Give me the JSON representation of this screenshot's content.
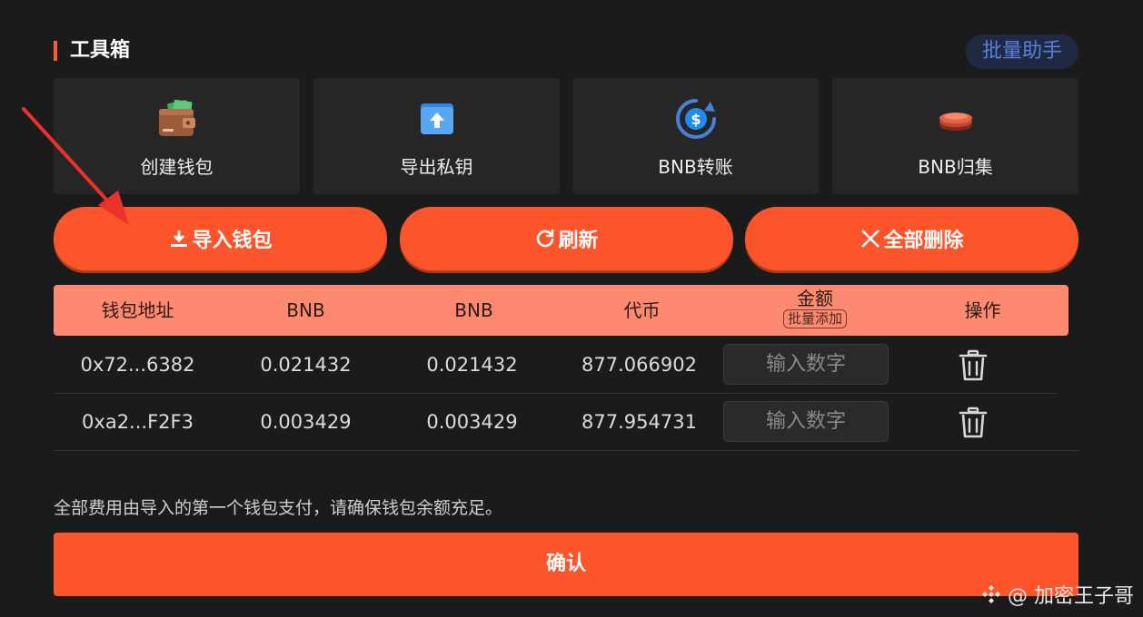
{
  "section": {
    "title": "工具箱",
    "batch_helper": "批量助手"
  },
  "tools": [
    {
      "label": "创建钱包",
      "icon": "wallet-icon"
    },
    {
      "label": "导出私钥",
      "icon": "upload-folder-icon"
    },
    {
      "label": "BNB转账",
      "icon": "coin-transfer-icon"
    },
    {
      "label": "BNB归集",
      "icon": "coin-stack-icon"
    }
  ],
  "actions": {
    "import_label": "导入钱包",
    "refresh_label": "刷新",
    "delete_all_label": "全部删除"
  },
  "table": {
    "headers": {
      "address": "钱包地址",
      "bnb1": "BNB",
      "bnb2": "BNB",
      "token": "代币",
      "amount": "金额",
      "batch_add": "批量添加",
      "operation": "操作"
    },
    "input_placeholder": "输入数字",
    "rows": [
      {
        "address": "0x72...6382",
        "bnb1": "0.021432",
        "bnb2": "0.021432",
        "token": "877.066902"
      },
      {
        "address": "0xa2...F2F3",
        "bnb1": "0.003429",
        "bnb2": "0.003429",
        "token": "877.954731"
      }
    ]
  },
  "notice": "全部费用由导入的第一个钱包支付，请确保钱包余额充足。",
  "confirm_label": "确认",
  "watermark": "@ 加密王子哥",
  "colors": {
    "background": "#1b1b1c",
    "accent": "#fd552b",
    "table_header": "#fd8a70",
    "batch_helper_text": "#5b7fe0",
    "annotation_arrow": "#e8322a"
  }
}
